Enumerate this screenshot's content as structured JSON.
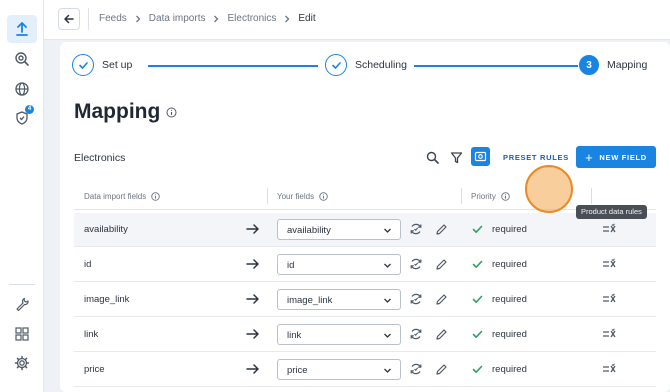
{
  "breadcrumb": {
    "items": [
      "Feeds",
      "Data imports",
      "Electronics"
    ],
    "current": "Edit"
  },
  "stepper": {
    "steps": [
      {
        "label": "Set up",
        "state": "done"
      },
      {
        "label": "Scheduling",
        "state": "done"
      },
      {
        "label": "Mapping",
        "state": "current",
        "number": "3"
      }
    ]
  },
  "page": {
    "title": "Mapping"
  },
  "section": {
    "name": "Electronics",
    "preset_rules_label": "PRESET RULES",
    "new_field_label": "NEW FIELD"
  },
  "table": {
    "headers": {
      "data_import_fields": "Data import fields",
      "your_fields": "Your fields",
      "priority": "Priority"
    },
    "rows": [
      {
        "source": "availability",
        "target": "availability",
        "priority": "required"
      },
      {
        "source": "id",
        "target": "id",
        "priority": "required"
      },
      {
        "source": "image_link",
        "target": "image_link",
        "priority": "required"
      },
      {
        "source": "link",
        "target": "link",
        "priority": "required"
      },
      {
        "source": "price",
        "target": "price",
        "priority": "required"
      }
    ]
  },
  "tooltip": {
    "text": "Product data rules"
  },
  "sidebar": {
    "notification_count": "4"
  },
  "colors": {
    "accent": "#1a84e3",
    "highlight": "#e98a26",
    "check": "#2fa06a"
  }
}
